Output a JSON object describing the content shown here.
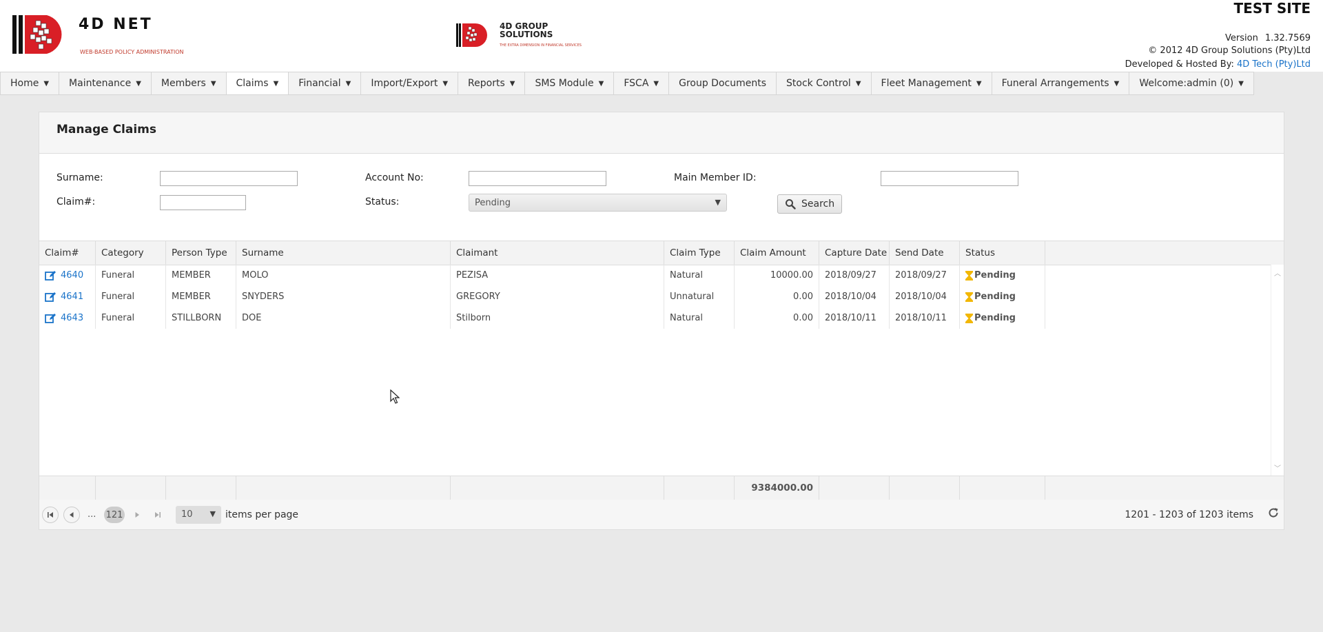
{
  "header": {
    "site_label": "TEST SITE",
    "version_label": "Version",
    "version_value": "1.32.7569",
    "copyright": "© 2012 4D Group Solutions (Pty)Ltd",
    "hosted_prefix": "Developed & Hosted By: ",
    "hosted_link": "4D Tech (Pty)Ltd",
    "logo1_title": "4D NET",
    "logo1_subtitle": "WEB-BASED POLICY ADMINISTRATION",
    "logo2_title_line1": "4D GROUP",
    "logo2_title_line2": "SOLUTIONS",
    "logo2_subtitle": "THE EXTRA DIMENSION IN FINANCIAL SERVICES"
  },
  "menu": [
    {
      "label": "Home",
      "caret": true
    },
    {
      "label": "Maintenance",
      "caret": true
    },
    {
      "label": "Members",
      "caret": true
    },
    {
      "label": "Claims",
      "caret": true,
      "active": true
    },
    {
      "label": "Financial",
      "caret": true
    },
    {
      "label": "Import/Export",
      "caret": true
    },
    {
      "label": "Reports",
      "caret": true
    },
    {
      "label": "SMS Module",
      "caret": true
    },
    {
      "label": "FSCA",
      "caret": true
    },
    {
      "label": "Group Documents",
      "caret": false
    },
    {
      "label": "Stock Control",
      "caret": true
    },
    {
      "label": "Fleet Management",
      "caret": true
    },
    {
      "label": "Funeral Arrangements",
      "caret": true
    },
    {
      "label": "Welcome:admin (0)",
      "caret": true
    }
  ],
  "panel": {
    "title": "Manage Claims"
  },
  "filters": {
    "surname_label": "Surname:",
    "surname_value": "",
    "account_label": "Account No:",
    "account_value": "",
    "member_id_label": "Main Member ID:",
    "member_id_value": "",
    "claim_label": "Claim#:",
    "claim_value": "",
    "status_label": "Status:",
    "status_value": "Pending",
    "search_label": "Search"
  },
  "grid": {
    "columns": [
      "Claim#",
      "Category",
      "Person Type",
      "Surname",
      "Claimant",
      "Claim Type",
      "Claim Amount",
      "Capture Date",
      "Send Date",
      "Status"
    ],
    "rows": [
      {
        "claim": "4640",
        "category": "Funeral",
        "person_type": "MEMBER",
        "surname": "MOLO",
        "claimant": "PEZISA",
        "claim_type": "Natural",
        "amount": "10000.00",
        "capture_date": "2018/09/27",
        "send_date": "2018/09/27",
        "status": "Pending"
      },
      {
        "claim": "4641",
        "category": "Funeral",
        "person_type": "MEMBER",
        "surname": "SNYDERS",
        "claimant": "GREGORY",
        "claim_type": "Unnatural",
        "amount": "0.00",
        "capture_date": "2018/10/04",
        "send_date": "2018/10/04",
        "status": "Pending"
      },
      {
        "claim": "4643",
        "category": "Funeral",
        "person_type": "STILLBORN",
        "surname": "DOE",
        "claimant": "Stilborn",
        "claim_type": "Natural",
        "amount": "0.00",
        "capture_date": "2018/10/11",
        "send_date": "2018/10/11",
        "status": "Pending"
      }
    ],
    "total_amount": "9384000.00"
  },
  "pager": {
    "dots": "...",
    "current_page": "121",
    "page_size": "10",
    "items_per_page_label": "items per page",
    "info": "1201 - 1203 of 1203 items"
  },
  "colors": {
    "link": "#1a73c9",
    "logo_red": "#d91f26",
    "hourglass": "#f2b705"
  }
}
